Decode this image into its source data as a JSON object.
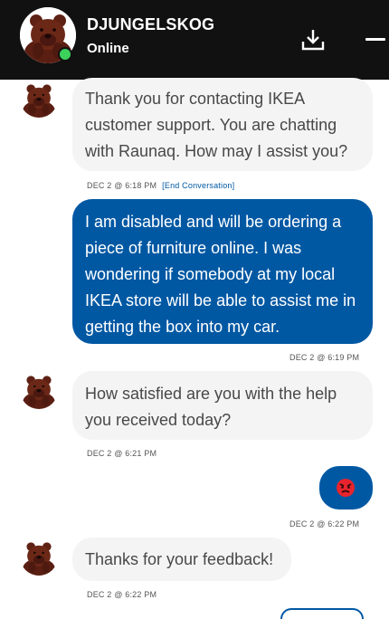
{
  "header": {
    "title": "DJUNGELSKOG",
    "status": "Online",
    "download_icon": "download-icon",
    "minimize_icon": "minimize-icon"
  },
  "messages": [
    {
      "from": "agent",
      "lines": [
        "Thank you for contacting IKEA",
        "customer support. You are chatting",
        "with Raunaq. How may I assist you?"
      ],
      "timestamp": "DEC 2 @ 6:18 PM",
      "link": "[End Conversation]"
    },
    {
      "from": "user",
      "lines": [
        "I am disabled and will be ordering a",
        "piece of furniture online. I was",
        "wondering if somebody at my local",
        "IKEA store will be able to assist me in",
        "getting the box into my car."
      ],
      "timestamp": "DEC 2 @ 6:19 PM"
    },
    {
      "from": "agent",
      "lines": [
        "How satisfied are you with the help",
        "you received today?"
      ],
      "timestamp": "DEC 2 @ 6:21 PM"
    },
    {
      "from": "user",
      "emoji": "angry-face-icon",
      "timestamp": "DEC 2 @ 6:22 PM"
    },
    {
      "from": "agent",
      "lines": [
        "Thanks for your feedback!"
      ],
      "timestamp": "DEC 2 @ 6:22 PM"
    }
  ],
  "colors": {
    "header_bg": "#111111",
    "agent_bubble": "#f4f4f4",
    "user_bubble": "#0058a3",
    "online": "#3bd15b"
  }
}
